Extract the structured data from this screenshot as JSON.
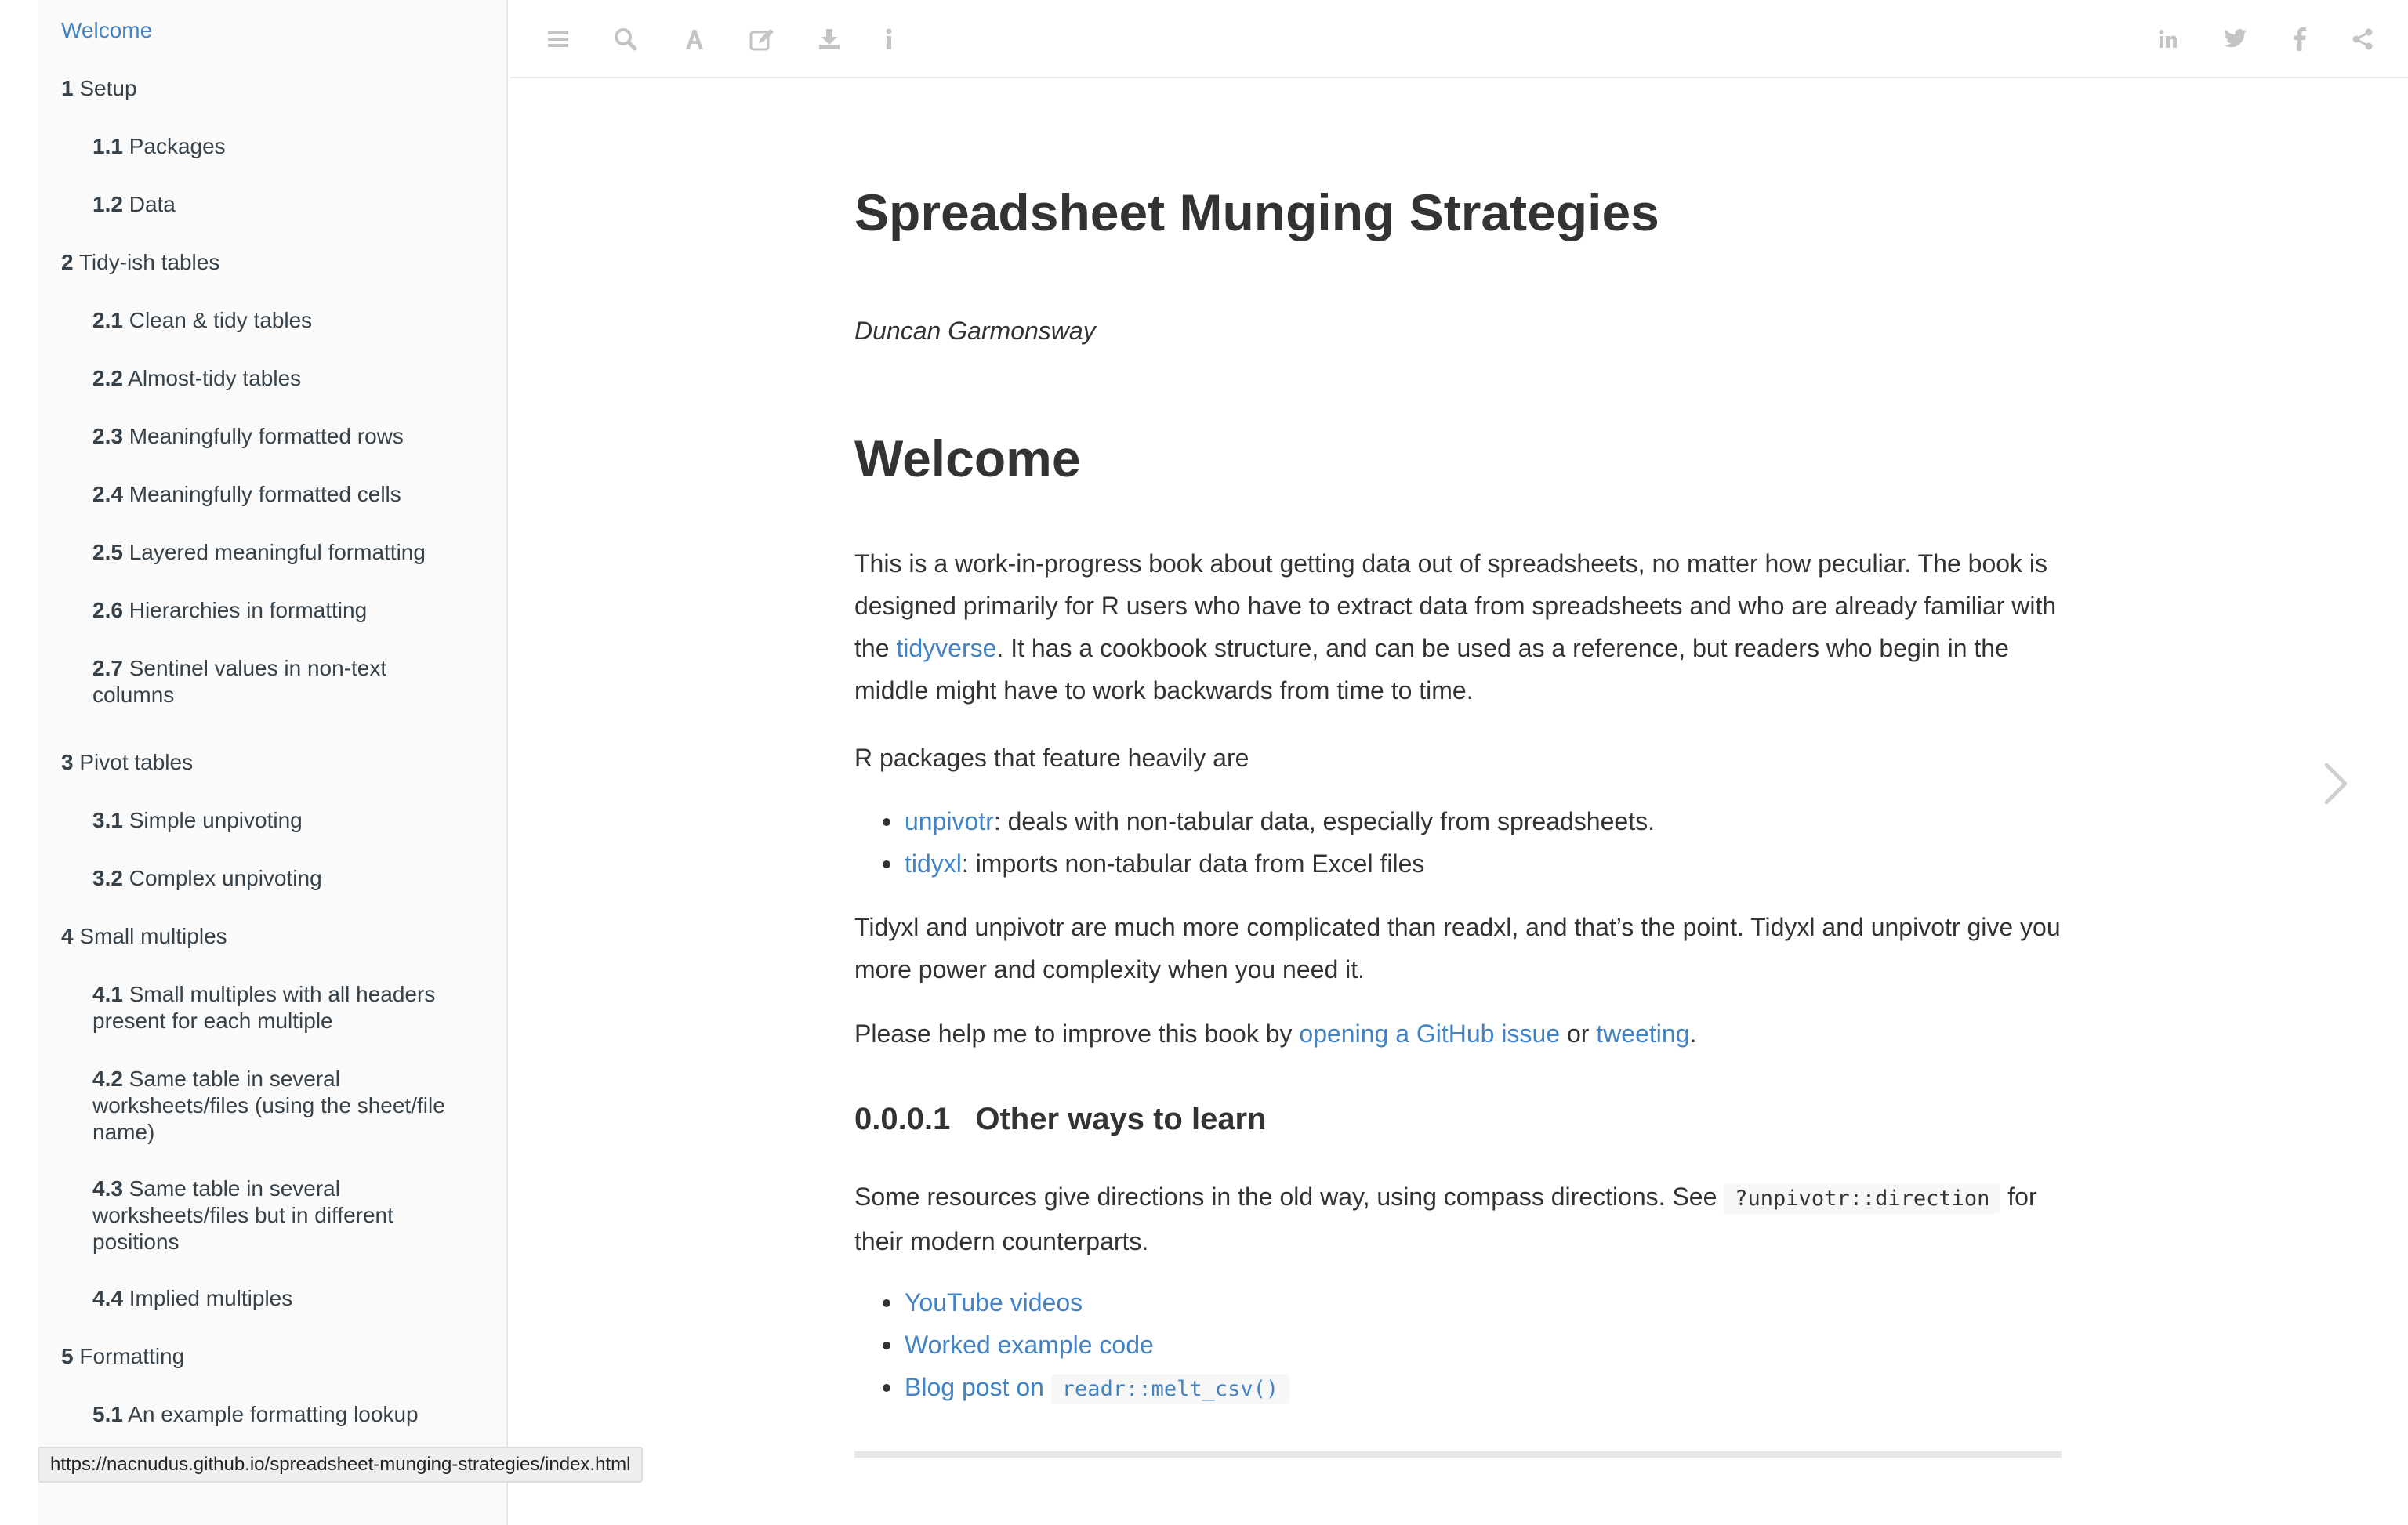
{
  "sidebar": {
    "items": [
      {
        "level": 1,
        "num": "",
        "label": "Welcome",
        "active": true
      },
      {
        "level": 1,
        "num": "1",
        "label": "Setup"
      },
      {
        "level": 2,
        "num": "1.1",
        "label": "Packages"
      },
      {
        "level": 2,
        "num": "1.2",
        "label": "Data"
      },
      {
        "level": 1,
        "num": "2",
        "label": "Tidy-ish tables"
      },
      {
        "level": 2,
        "num": "2.1",
        "label": "Clean & tidy tables"
      },
      {
        "level": 2,
        "num": "2.2",
        "label": "Almost-tidy tables"
      },
      {
        "level": 2,
        "num": "2.3",
        "label": "Meaningfully formatted rows"
      },
      {
        "level": 2,
        "num": "2.4",
        "label": "Meaningfully formatted cells"
      },
      {
        "level": 2,
        "num": "2.5",
        "label": "Layered meaningful formatting"
      },
      {
        "level": 2,
        "num": "2.6",
        "label": "Hierarchies in formatting"
      },
      {
        "level": 2,
        "num": "2.7",
        "label": "Sentinel values in non-text columns"
      },
      {
        "level": 1,
        "num": "3",
        "label": "Pivot tables"
      },
      {
        "level": 2,
        "num": "3.1",
        "label": "Simple unpivoting"
      },
      {
        "level": 2,
        "num": "3.2",
        "label": "Complex unpivoting"
      },
      {
        "level": 1,
        "num": "4",
        "label": "Small multiples"
      },
      {
        "level": 2,
        "num": "4.1",
        "label": "Small multiples with all headers present for each multiple"
      },
      {
        "level": 2,
        "num": "4.2",
        "label": "Same table in several worksheets/files (using the sheet/file name)"
      },
      {
        "level": 2,
        "num": "4.3",
        "label": "Same table in several worksheets/files but in different positions"
      },
      {
        "level": 2,
        "num": "4.4",
        "label": "Implied multiples"
      },
      {
        "level": 1,
        "num": "5",
        "label": "Formatting"
      },
      {
        "level": 2,
        "num": "5.1",
        "label": "An example formatting lookup"
      }
    ]
  },
  "toolbar": {
    "left": [
      {
        "name": "toc-toggle-icon"
      },
      {
        "name": "search-icon"
      },
      {
        "name": "font-settings-icon"
      },
      {
        "name": "edit-icon"
      },
      {
        "name": "download-icon"
      },
      {
        "name": "info-icon"
      }
    ],
    "right": [
      {
        "name": "linkedin-icon"
      },
      {
        "name": "twitter-icon"
      },
      {
        "name": "facebook-icon"
      },
      {
        "name": "share-icon"
      }
    ],
    "icon_color": "#c4c4c4"
  },
  "content": {
    "title": "Spreadsheet Munging Strategies",
    "author": "Duncan Garmonsway",
    "heading": "Welcome",
    "intro_before": "This is a work-in-progress book about getting data out of spreadsheets, no matter how peculiar. The book is designed primarily for R users who have to extract data from spreadsheets and who are already familiar with the ",
    "intro_link": "tidyverse",
    "intro_after": ". It has a cookbook structure, and can be used as a reference, but readers who begin in the middle might have to work backwards from time to time.",
    "packages_intro": "R packages that feature heavily are",
    "packages": [
      {
        "name": "unpivotr",
        "desc": ": deals with non-tabular data, especially from spreadsheets."
      },
      {
        "name": "tidyxl",
        "desc": ": imports non-tabular data from Excel files"
      }
    ],
    "complexity": "Tidyxl and unpivotr are much more complicated than readxl, and that’s the point. Tidyxl and unpivotr give you more power and complexity when you need it.",
    "help_before": "Please help me to improve this book by ",
    "help_link1": "opening a GitHub issue",
    "help_mid": " or ",
    "help_link2": "tweeting",
    "help_after": ".",
    "sub_num": "0.0.0.1",
    "sub_title": "Other ways to learn",
    "resources_before": "Some resources give directions in the old way, using compass directions. See ",
    "resources_code": "?unpivotr::direction",
    "resources_after": " for their modern counterparts.",
    "links": {
      "youtube": "YouTube videos",
      "worked": "Worked example code",
      "blog": "Blog post on ",
      "blog_code": "readr::melt_csv()"
    }
  },
  "statusbar": {
    "url": "https://nacnudus.github.io/spreadsheet-munging-strategies/index.html"
  },
  "colors": {
    "link": "#4183c4",
    "text": "#333333",
    "sidebar_bg": "#fafafa"
  }
}
